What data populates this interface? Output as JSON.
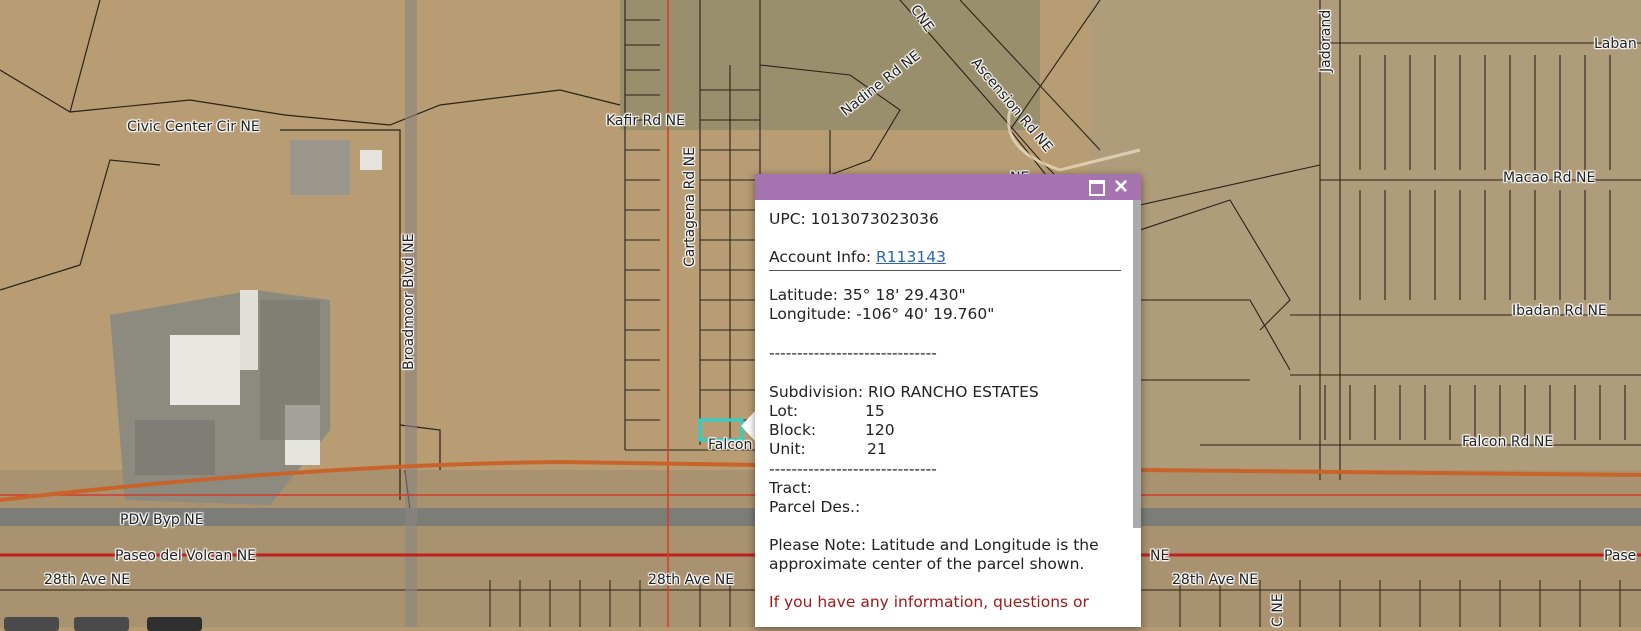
{
  "map": {
    "road_labels": [
      {
        "text": "Civic Center Cir NE"
      },
      {
        "text": "Kafir Rd NE"
      },
      {
        "text": "Cartagena Rd NE"
      },
      {
        "text": "Broadmoor Blvd NE"
      },
      {
        "text": "Nadine Rd NE"
      },
      {
        "text": "Ascension Rd NE"
      },
      {
        "text": "Jadorand"
      },
      {
        "text": "Laban"
      },
      {
        "text": "Macao Rd NE"
      },
      {
        "text": "Ibadan Rd NE"
      },
      {
        "text": "Falcon Rd NE"
      },
      {
        "text": "Falcon"
      },
      {
        "text": "PDV Byp NE"
      },
      {
        "text": "Paseo del Volcan NE"
      },
      {
        "text": "28th Ave NE"
      },
      {
        "text": "28th Ave NE"
      },
      {
        "text": "28th Ave NE"
      },
      {
        "text": "NE"
      },
      {
        "text": "Pase"
      },
      {
        "text": "NE"
      },
      {
        "text": "C NE"
      },
      {
        "text": "CNE"
      }
    ]
  },
  "popup": {
    "upc": "UPC: 1013073023036",
    "account_label": "Account Info: ",
    "account_link": "R113143",
    "latitude": "Latitude: 35° 18' 29.430\"",
    "longitude": "Longitude: -106° 40' 19.760\"",
    "separator": "------------------------------",
    "subdivision": "Subdivision: RIO RANCHO ESTATES",
    "lot_label": "Lot:",
    "lot_value": "15",
    "block_label": "Block:",
    "block_value": "120",
    "unit_label": "Unit:",
    "unit_value": "21",
    "tract_label": "Tract:",
    "parcel_des_label": "Parcel Des.:",
    "note_line1": "Please Note: Latitude and Longitude is the",
    "note_line2": "approximate center of the parcel shown.",
    "contact_line": "If you have any information, questions or"
  },
  "colors": {
    "popup_header": "#a473b0",
    "link": "#2a66b3",
    "highlight": "#2ad1c9",
    "red_line": "#d43a2a",
    "orange_line": "#c8642a"
  }
}
